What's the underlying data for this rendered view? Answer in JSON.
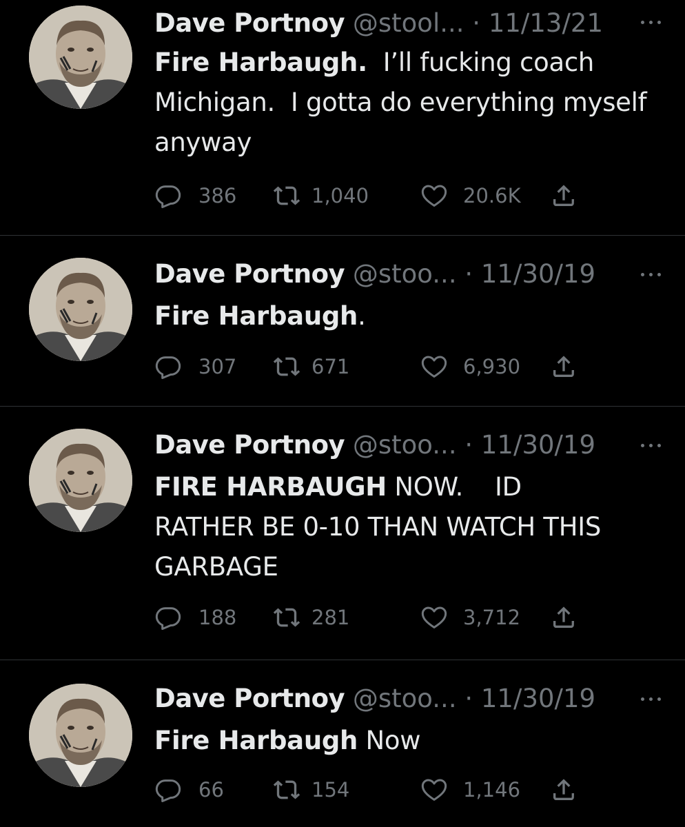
{
  "colors": {
    "background": "#000000",
    "text_primary": "#e7e9ea",
    "text_secondary": "#71767b",
    "divider": "#2f3336"
  },
  "icons": {
    "reply": "reply-icon",
    "retweet": "retweet-icon",
    "like": "heart-icon",
    "share": "share-icon",
    "more": "more-dots-icon"
  },
  "tweets": [
    {
      "name": "Dave Portnoy",
      "handle": "@stool...",
      "sep": "·",
      "date": "11/13/21",
      "text_bold": "Fire Harbaugh.",
      "text_rest": "  I’ll fucking coach Michigan.  I gotta do everything myself anyway",
      "replies": "386",
      "retweets": "1,040",
      "likes": "20.6K"
    },
    {
      "name": "Dave Portnoy",
      "handle": "@stoo...",
      "sep": "·",
      "date": "11/30/19",
      "text_bold": "Fire Harbaugh",
      "text_rest": ".",
      "replies": "307",
      "retweets": "671",
      "likes": "6,930"
    },
    {
      "name": "Dave Portnoy",
      "handle": "@stoo...",
      "sep": "·",
      "date": "11/30/19",
      "text_bold": "FIRE HARBAUGH",
      "text_rest": " NOW.    ID RATHER BE 0-10 THAN WATCH THIS GARBAGE",
      "replies": "188",
      "retweets": "281",
      "likes": "3,712"
    },
    {
      "name": "Dave Portnoy",
      "handle": "@stoo...",
      "sep": "·",
      "date": "11/30/19",
      "text_bold": "Fire Harbaugh",
      "text_rest": " Now",
      "replies": "66",
      "retweets": "154",
      "likes": "1,146"
    }
  ]
}
